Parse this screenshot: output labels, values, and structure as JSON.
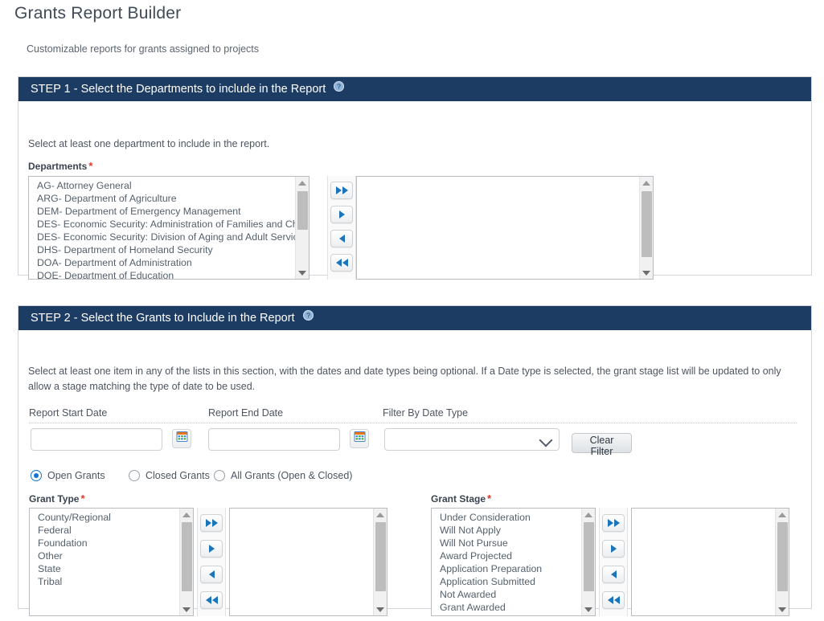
{
  "page": {
    "title": "Grants Report Builder",
    "subtitle": "Customizable reports for grants assigned to projects"
  },
  "step1": {
    "header": "STEP 1 - Select the Departments to include in the Report",
    "help_icon": "help-circle-icon",
    "instruction": "Select at least one department to include in the report.",
    "departments_label": "Departments",
    "required_marker": "*",
    "available": [
      "AG- Attorney General",
      "ARG- Department of Agriculture",
      "DEM- Department of Emergency Management",
      "DES- Economic Security: Administration of Families and Children",
      "DES- Economic Security: Division of Aging and Adult Services",
      "DHS- Department of Homeland Security",
      "DOA- Department of Administration",
      "DOE- Department of Education"
    ],
    "selected": [],
    "transfer_buttons": [
      {
        "name": "move-all-right",
        "icon": "double-chevron-right-icon"
      },
      {
        "name": "move-right",
        "icon": "chevron-right-icon"
      },
      {
        "name": "move-left",
        "icon": "chevron-left-icon"
      },
      {
        "name": "move-all-left",
        "icon": "double-chevron-left-icon"
      }
    ]
  },
  "step2": {
    "header": "STEP 2 - Select the Grants to Include in the Report",
    "help_icon": "help-circle-icon",
    "instruction": "Select at least one item in any of the lists in this section, with the dates and date types being optional. If a Date type is selected, the grant stage list will be updated to only allow a stage matching the type of date to be used.",
    "report_start_date": {
      "label": "Report Start Date",
      "value": "",
      "placeholder": "",
      "calendar_icon": "calendar-icon"
    },
    "report_end_date": {
      "label": "Report End Date",
      "value": "",
      "placeholder": "",
      "calendar_icon": "calendar-icon"
    },
    "filter_by_date_type": {
      "label": "Filter By Date Type",
      "value": "",
      "options": [
        ""
      ],
      "chevron_icon": "chevron-down-icon"
    },
    "clear_filter_label": "Clear Filter",
    "grant_status_options": [
      {
        "label": "Open Grants",
        "selected": true
      },
      {
        "label": "Closed Grants",
        "selected": false
      },
      {
        "label": "All Grants (Open & Closed)",
        "selected": false
      }
    ],
    "grant_type": {
      "label": "Grant Type",
      "required_marker": "*",
      "available": [
        "County/Regional",
        "Federal",
        "Foundation",
        "Other",
        "State",
        "Tribal"
      ],
      "selected": []
    },
    "grant_stage": {
      "label": "Grant Stage",
      "required_marker": "*",
      "available": [
        "Under Consideration",
        "Will Not Apply",
        "Will Not Pursue",
        "Award Projected",
        "Application Preparation",
        "Application Submitted",
        "Not Awarded",
        "Grant Awarded"
      ],
      "selected": []
    },
    "transfer_buttons": [
      {
        "name": "move-all-right",
        "icon": "double-chevron-right-icon"
      },
      {
        "name": "move-right",
        "icon": "chevron-right-icon"
      },
      {
        "name": "move-left",
        "icon": "chevron-left-icon"
      },
      {
        "name": "move-all-left",
        "icon": "double-chevron-left-icon"
      }
    ]
  },
  "colors": {
    "header_bar": "#1d3c64",
    "accent_blue": "#1b75bb",
    "required_red": "#e4352b",
    "radio_selected": "#1673d1"
  }
}
